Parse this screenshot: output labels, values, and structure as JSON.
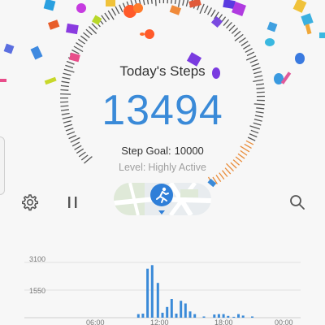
{
  "header": {
    "title": "Today's Steps",
    "steps": "13494",
    "goal_label": "Step Goal:",
    "goal_value": "10000",
    "level_label": "Level:",
    "level_value": "Highly Active"
  },
  "progress": {
    "steps": 13494,
    "goal": 10000
  },
  "toolbar": {
    "settings_icon": "gear-icon",
    "pause_icon": "pause-icon",
    "activity_icon": "running-person-icon",
    "search_icon": "search-icon"
  },
  "colors": {
    "accent": "#3a8ad8",
    "gauge_tick": "#555555",
    "gauge_progress": "#e98c3a",
    "background": "#f7f7f7"
  },
  "chart_data": {
    "type": "bar",
    "x_ticks": [
      "06:00",
      "12:00",
      "18:00",
      "00:00"
    ],
    "y_ticks": [
      "3100",
      "1550"
    ],
    "ylim": [
      0,
      3100
    ],
    "xlim": [
      0,
      24
    ],
    "bars": [
      {
        "t": 9.9,
        "v": 200
      },
      {
        "t": 10.3,
        "v": 230
      },
      {
        "t": 10.7,
        "v": 2750
      },
      {
        "t": 11.1,
        "v": 2950
      },
      {
        "t": 11.6,
        "v": 1950
      },
      {
        "t": 12.0,
        "v": 280
      },
      {
        "t": 12.4,
        "v": 600
      },
      {
        "t": 12.8,
        "v": 1050
      },
      {
        "t": 13.2,
        "v": 230
      },
      {
        "t": 13.6,
        "v": 950
      },
      {
        "t": 14.0,
        "v": 800
      },
      {
        "t": 14.4,
        "v": 350
      },
      {
        "t": 14.8,
        "v": 200
      },
      {
        "t": 15.6,
        "v": 70
      },
      {
        "t": 16.5,
        "v": 180
      },
      {
        "t": 16.9,
        "v": 200
      },
      {
        "t": 17.3,
        "v": 200
      },
      {
        "t": 17.7,
        "v": 100
      },
      {
        "t": 18.2,
        "v": 50
      },
      {
        "t": 18.6,
        "v": 200
      },
      {
        "t": 19.0,
        "v": 120
      },
      {
        "t": 19.8,
        "v": 70
      }
    ]
  }
}
